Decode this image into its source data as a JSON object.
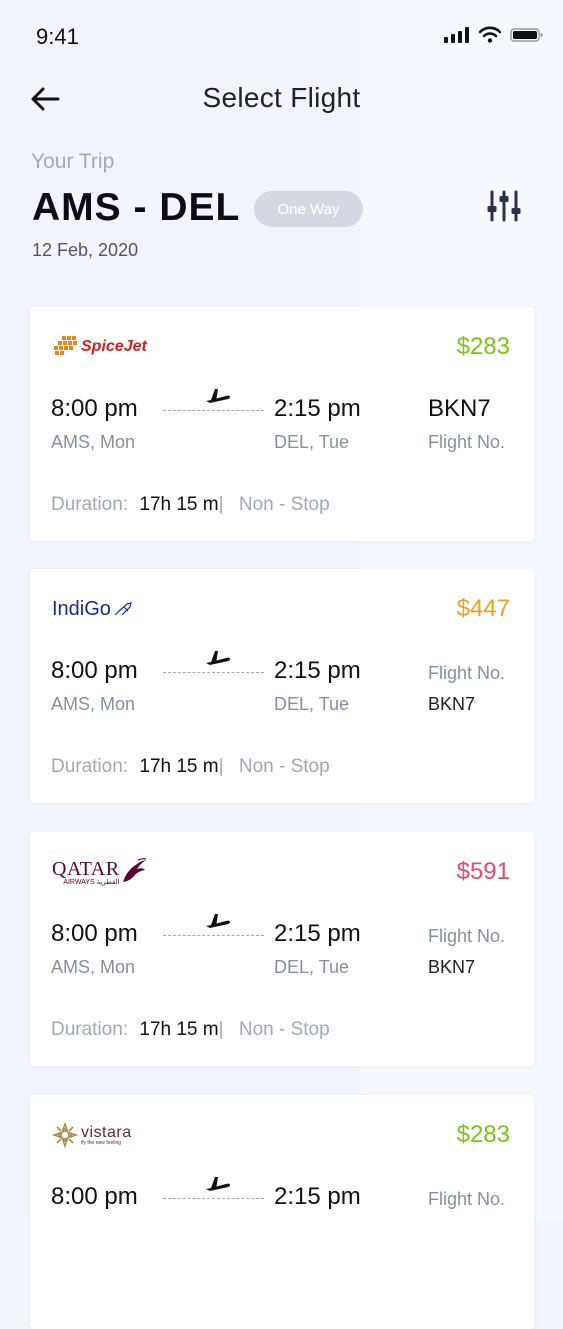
{
  "status_bar": {
    "time": "9:41"
  },
  "header": {
    "title": "Select Flight"
  },
  "trip": {
    "label": "Your Trip",
    "route": "AMS - DEL",
    "type": "One Way",
    "date": "12 Feb, 2020"
  },
  "flights": [
    {
      "airline_logo": "SpiceJet",
      "price": "$283",
      "price_color": "#7cc51b",
      "dep_time": "8:00 pm",
      "dep_loc": "AMS, Mon",
      "arr_time": "2:15 pm",
      "arr_loc": "DEL, Tue",
      "flight_no_value": "BKN7",
      "flight_no_label": "Flight No.",
      "duration_label": "Duration:",
      "duration_value": "17h 15 m",
      "separator": "|",
      "stops": "Non - Stop"
    },
    {
      "airline_logo": "IndiGo",
      "price": "$447",
      "price_color": "#f4a11e",
      "dep_time": "8:00 pm",
      "dep_loc": "AMS, Mon",
      "arr_time": "2:15 pm",
      "arr_loc": "DEL, Tue",
      "flight_no_label": "Flight No.",
      "flight_no_value": "BKN7",
      "duration_label": "Duration:",
      "duration_value": "17h 15 m",
      "separator": "|",
      "stops": "Non - Stop"
    },
    {
      "airline_logo": "QATAR",
      "airline_logo_sub": "AIRWAYS القطرية",
      "price": "$591",
      "price_color": "#f0466a",
      "dep_time": "8:00 pm",
      "dep_loc": "AMS, Mon",
      "arr_time": "2:15 pm",
      "arr_loc": "DEL, Tue",
      "flight_no_label": "Flight No.",
      "flight_no_value": "BKN7",
      "duration_label": "Duration:",
      "duration_value": "17h 15 m",
      "separator": "|",
      "stops": "Non - Stop"
    },
    {
      "airline_logo": "vistara",
      "airline_logo_sub": "fly the new feeling",
      "price": "$283",
      "price_color": "#7cc51b",
      "dep_time": "8:00 pm",
      "arr_time": "2:15 pm",
      "flight_no_label": "Flight No."
    }
  ],
  "icons": {
    "back": "arrow-left-icon",
    "filter": "sliders-icon",
    "plane": "plane-icon",
    "signal": "signal-icon",
    "wifi": "wifi-icon",
    "battery": "battery-icon"
  }
}
